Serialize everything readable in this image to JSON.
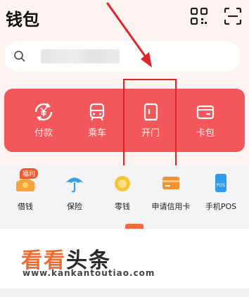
{
  "header": {
    "title": "钱包"
  },
  "search": {
    "placeholder": ""
  },
  "panel": {
    "items": [
      {
        "label": "付款",
        "icon": "payment-yuan-icon"
      },
      {
        "label": "乘车",
        "icon": "bus-icon"
      },
      {
        "label": "开门",
        "icon": "door-icon"
      },
      {
        "label": "卡包",
        "icon": "card-wallet-icon"
      }
    ]
  },
  "services": {
    "items": [
      {
        "label": "借钱",
        "icon": "loan-icon",
        "badge": "福利"
      },
      {
        "label": "保险",
        "icon": "umbrella-icon"
      },
      {
        "label": "零钱",
        "icon": "coins-icon"
      },
      {
        "label": "申请信用卡",
        "icon": "credit-card-icon"
      },
      {
        "label": "手机POS",
        "icon": "pos-phone-icon",
        "icon_text": "POS"
      }
    ]
  },
  "watermark": {
    "text_orange": "看看",
    "text_dark": "头条",
    "url": "www.kankantoutiao.com"
  },
  "colors": {
    "panel": "#f2585b",
    "highlight_box": "#e0242c",
    "arrow": "#e0242c",
    "background": "#f4f4f6"
  }
}
